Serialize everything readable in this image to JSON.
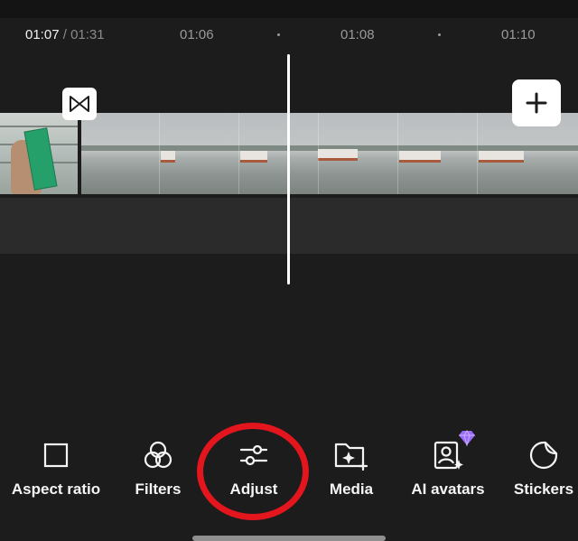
{
  "timeline": {
    "current_time": "01:07",
    "separator": " / ",
    "total_time": "01:31",
    "ticks": [
      "01:06",
      "01:08",
      "01:10"
    ]
  },
  "clips": {
    "transition_icon": "bowtie-transition-icon",
    "add_icon": "plus-icon"
  },
  "toolbar": {
    "items": [
      {
        "label": "Aspect ratio",
        "icon": "square-icon"
      },
      {
        "label": "Filters",
        "icon": "filters-icon"
      },
      {
        "label": "Adjust",
        "icon": "sliders-icon"
      },
      {
        "label": "Media",
        "icon": "media-folder-icon"
      },
      {
        "label": "AI avatars",
        "icon": "ai-avatar-icon"
      },
      {
        "label": "Stickers",
        "icon": "sticker-icon"
      }
    ]
  },
  "colors": {
    "background": "#1c1c1c",
    "highlight_circle": "#e3151d",
    "badge_purple": "#9b6cf5"
  }
}
